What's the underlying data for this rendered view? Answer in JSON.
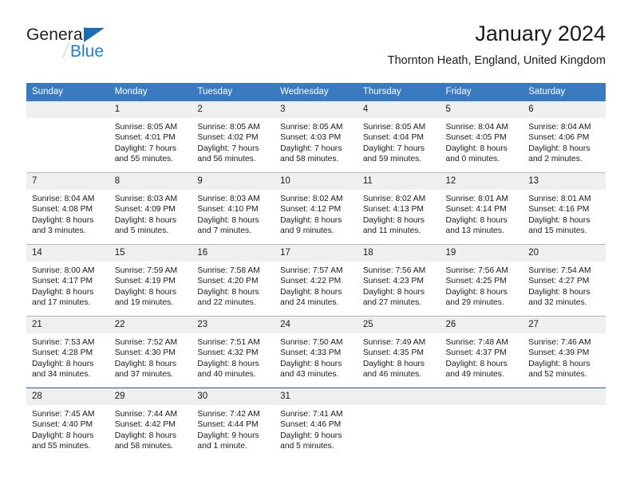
{
  "brand": {
    "name_top": "General",
    "name_bottom": "Blue",
    "triangle_color": "#1a6cb5",
    "blue_color": "#1a7fd4"
  },
  "header": {
    "title": "January 2024",
    "subtitle": "Thornton Heath, England, United Kingdom",
    "header_bg": "#3a7ac0",
    "header_text_color": "#ffffff",
    "daynum_bg": "#efefef"
  },
  "columns": [
    "Sunday",
    "Monday",
    "Tuesday",
    "Wednesday",
    "Thursday",
    "Friday",
    "Saturday"
  ],
  "labels": {
    "sunrise_prefix": "Sunrise:",
    "sunset_prefix": "Sunset:",
    "daylight_prefix": "Daylight:"
  },
  "weeks": [
    [
      {
        "day": "",
        "sunrise": "",
        "sunset": "",
        "daylight_line1": "",
        "daylight_line2": "",
        "empty": true
      },
      {
        "day": "1",
        "sunrise": "Sunrise: 8:05 AM",
        "sunset": "Sunset: 4:01 PM",
        "daylight_line1": "Daylight: 7 hours",
        "daylight_line2": "and 55 minutes.",
        "empty": false
      },
      {
        "day": "2",
        "sunrise": "Sunrise: 8:05 AM",
        "sunset": "Sunset: 4:02 PM",
        "daylight_line1": "Daylight: 7 hours",
        "daylight_line2": "and 56 minutes.",
        "empty": false
      },
      {
        "day": "3",
        "sunrise": "Sunrise: 8:05 AM",
        "sunset": "Sunset: 4:03 PM",
        "daylight_line1": "Daylight: 7 hours",
        "daylight_line2": "and 58 minutes.",
        "empty": false
      },
      {
        "day": "4",
        "sunrise": "Sunrise: 8:05 AM",
        "sunset": "Sunset: 4:04 PM",
        "daylight_line1": "Daylight: 7 hours",
        "daylight_line2": "and 59 minutes.",
        "empty": false
      },
      {
        "day": "5",
        "sunrise": "Sunrise: 8:04 AM",
        "sunset": "Sunset: 4:05 PM",
        "daylight_line1": "Daylight: 8 hours",
        "daylight_line2": "and 0 minutes.",
        "empty": false
      },
      {
        "day": "6",
        "sunrise": "Sunrise: 8:04 AM",
        "sunset": "Sunset: 4:06 PM",
        "daylight_line1": "Daylight: 8 hours",
        "daylight_line2": "and 2 minutes.",
        "empty": false
      }
    ],
    [
      {
        "day": "7",
        "sunrise": "Sunrise: 8:04 AM",
        "sunset": "Sunset: 4:08 PM",
        "daylight_line1": "Daylight: 8 hours",
        "daylight_line2": "and 3 minutes.",
        "empty": false
      },
      {
        "day": "8",
        "sunrise": "Sunrise: 8:03 AM",
        "sunset": "Sunset: 4:09 PM",
        "daylight_line1": "Daylight: 8 hours",
        "daylight_line2": "and 5 minutes.",
        "empty": false
      },
      {
        "day": "9",
        "sunrise": "Sunrise: 8:03 AM",
        "sunset": "Sunset: 4:10 PM",
        "daylight_line1": "Daylight: 8 hours",
        "daylight_line2": "and 7 minutes.",
        "empty": false
      },
      {
        "day": "10",
        "sunrise": "Sunrise: 8:02 AM",
        "sunset": "Sunset: 4:12 PM",
        "daylight_line1": "Daylight: 8 hours",
        "daylight_line2": "and 9 minutes.",
        "empty": false
      },
      {
        "day": "11",
        "sunrise": "Sunrise: 8:02 AM",
        "sunset": "Sunset: 4:13 PM",
        "daylight_line1": "Daylight: 8 hours",
        "daylight_line2": "and 11 minutes.",
        "empty": false
      },
      {
        "day": "12",
        "sunrise": "Sunrise: 8:01 AM",
        "sunset": "Sunset: 4:14 PM",
        "daylight_line1": "Daylight: 8 hours",
        "daylight_line2": "and 13 minutes.",
        "empty": false
      },
      {
        "day": "13",
        "sunrise": "Sunrise: 8:01 AM",
        "sunset": "Sunset: 4:16 PM",
        "daylight_line1": "Daylight: 8 hours",
        "daylight_line2": "and 15 minutes.",
        "empty": false
      }
    ],
    [
      {
        "day": "14",
        "sunrise": "Sunrise: 8:00 AM",
        "sunset": "Sunset: 4:17 PM",
        "daylight_line1": "Daylight: 8 hours",
        "daylight_line2": "and 17 minutes.",
        "empty": false
      },
      {
        "day": "15",
        "sunrise": "Sunrise: 7:59 AM",
        "sunset": "Sunset: 4:19 PM",
        "daylight_line1": "Daylight: 8 hours",
        "daylight_line2": "and 19 minutes.",
        "empty": false
      },
      {
        "day": "16",
        "sunrise": "Sunrise: 7:58 AM",
        "sunset": "Sunset: 4:20 PM",
        "daylight_line1": "Daylight: 8 hours",
        "daylight_line2": "and 22 minutes.",
        "empty": false
      },
      {
        "day": "17",
        "sunrise": "Sunrise: 7:57 AM",
        "sunset": "Sunset: 4:22 PM",
        "daylight_line1": "Daylight: 8 hours",
        "daylight_line2": "and 24 minutes.",
        "empty": false
      },
      {
        "day": "18",
        "sunrise": "Sunrise: 7:56 AM",
        "sunset": "Sunset: 4:23 PM",
        "daylight_line1": "Daylight: 8 hours",
        "daylight_line2": "and 27 minutes.",
        "empty": false
      },
      {
        "day": "19",
        "sunrise": "Sunrise: 7:56 AM",
        "sunset": "Sunset: 4:25 PM",
        "daylight_line1": "Daylight: 8 hours",
        "daylight_line2": "and 29 minutes.",
        "empty": false
      },
      {
        "day": "20",
        "sunrise": "Sunrise: 7:54 AM",
        "sunset": "Sunset: 4:27 PM",
        "daylight_line1": "Daylight: 8 hours",
        "daylight_line2": "and 32 minutes.",
        "empty": false
      }
    ],
    [
      {
        "day": "21",
        "sunrise": "Sunrise: 7:53 AM",
        "sunset": "Sunset: 4:28 PM",
        "daylight_line1": "Daylight: 8 hours",
        "daylight_line2": "and 34 minutes.",
        "empty": false
      },
      {
        "day": "22",
        "sunrise": "Sunrise: 7:52 AM",
        "sunset": "Sunset: 4:30 PM",
        "daylight_line1": "Daylight: 8 hours",
        "daylight_line2": "and 37 minutes.",
        "empty": false
      },
      {
        "day": "23",
        "sunrise": "Sunrise: 7:51 AM",
        "sunset": "Sunset: 4:32 PM",
        "daylight_line1": "Daylight: 8 hours",
        "daylight_line2": "and 40 minutes.",
        "empty": false
      },
      {
        "day": "24",
        "sunrise": "Sunrise: 7:50 AM",
        "sunset": "Sunset: 4:33 PM",
        "daylight_line1": "Daylight: 8 hours",
        "daylight_line2": "and 43 minutes.",
        "empty": false
      },
      {
        "day": "25",
        "sunrise": "Sunrise: 7:49 AM",
        "sunset": "Sunset: 4:35 PM",
        "daylight_line1": "Daylight: 8 hours",
        "daylight_line2": "and 46 minutes.",
        "empty": false
      },
      {
        "day": "26",
        "sunrise": "Sunrise: 7:48 AM",
        "sunset": "Sunset: 4:37 PM",
        "daylight_line1": "Daylight: 8 hours",
        "daylight_line2": "and 49 minutes.",
        "empty": false
      },
      {
        "day": "27",
        "sunrise": "Sunrise: 7:46 AM",
        "sunset": "Sunset: 4:39 PM",
        "daylight_line1": "Daylight: 8 hours",
        "daylight_line2": "and 52 minutes.",
        "empty": false
      }
    ],
    [
      {
        "day": "28",
        "sunrise": "Sunrise: 7:45 AM",
        "sunset": "Sunset: 4:40 PM",
        "daylight_line1": "Daylight: 8 hours",
        "daylight_line2": "and 55 minutes.",
        "empty": false
      },
      {
        "day": "29",
        "sunrise": "Sunrise: 7:44 AM",
        "sunset": "Sunset: 4:42 PM",
        "daylight_line1": "Daylight: 8 hours",
        "daylight_line2": "and 58 minutes.",
        "empty": false
      },
      {
        "day": "30",
        "sunrise": "Sunrise: 7:42 AM",
        "sunset": "Sunset: 4:44 PM",
        "daylight_line1": "Daylight: 9 hours",
        "daylight_line2": "and 1 minute.",
        "empty": false
      },
      {
        "day": "31",
        "sunrise": "Sunrise: 7:41 AM",
        "sunset": "Sunset: 4:46 PM",
        "daylight_line1": "Daylight: 9 hours",
        "daylight_line2": "and 5 minutes.",
        "empty": false
      },
      {
        "day": "",
        "sunrise": "",
        "sunset": "",
        "daylight_line1": "",
        "daylight_line2": "",
        "empty": true
      },
      {
        "day": "",
        "sunrise": "",
        "sunset": "",
        "daylight_line1": "",
        "daylight_line2": "",
        "empty": true
      },
      {
        "day": "",
        "sunrise": "",
        "sunset": "",
        "daylight_line1": "",
        "daylight_line2": "",
        "empty": true
      }
    ]
  ]
}
